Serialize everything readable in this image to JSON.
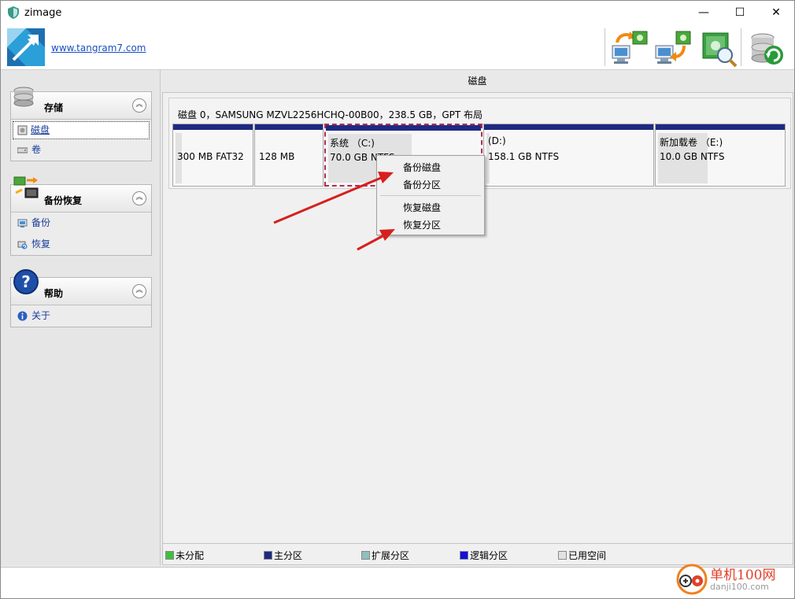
{
  "window": {
    "title": "zimage",
    "controls": [
      "—",
      "☐",
      "✕"
    ]
  },
  "header": {
    "site_link": "www.tangram7.com",
    "tools": [
      "backup-disk-icon",
      "restore-disk-icon",
      "browse-image-icon",
      "refresh-disk-icon"
    ]
  },
  "sidebar": {
    "panels": [
      {
        "title": "存储",
        "icon": "storage-icon",
        "items": [
          {
            "label": "磁盘",
            "icon": "disk-icon",
            "selected": true
          },
          {
            "label": "卷",
            "icon": "volume-icon",
            "selected": false
          }
        ]
      },
      {
        "title": "备份恢复",
        "icon": "backup-restore-icon",
        "items": [
          {
            "label": "备份",
            "icon": "backup-icon"
          },
          {
            "label": "恢复",
            "icon": "restore-icon"
          }
        ]
      },
      {
        "title": "帮助",
        "icon": "help-icon",
        "items": [
          {
            "label": "关于",
            "icon": "info-icon"
          }
        ]
      }
    ]
  },
  "main": {
    "title": "磁盘",
    "disk_label": "磁盘 0，SAMSUNG MZVL2256HCHQ-00B00，238.5 GB，GPT 布局",
    "partitions": [
      {
        "line1": "",
        "line2": "300 MB FAT32",
        "used_fraction": 0.08
      },
      {
        "line1": "",
        "line2": "128 MB",
        "used_fraction": 0.0
      },
      {
        "line1": "系统 （C:)",
        "line2": "70.0 GB NTFS",
        "used_fraction": 0.55
      },
      {
        "line1": "(D:)",
        "line2": "158.1 GB NTFS",
        "used_fraction": 0.02
      },
      {
        "line1": "新加载卷 （E:)",
        "line2": "10.0 GB NTFS",
        "used_fraction": 0.4
      }
    ]
  },
  "context_menu": {
    "items": [
      "备份磁盘",
      "备份分区",
      "恢复磁盘",
      "恢复分区"
    ]
  },
  "legend": [
    {
      "label": "未分配",
      "color": "#3fbf3f"
    },
    {
      "label": "主分区",
      "color": "#1e2a82"
    },
    {
      "label": "扩展分区",
      "color": "#8fbfbf"
    },
    {
      "label": "逻辑分区",
      "color": "#1010e0"
    },
    {
      "label": "已用空间",
      "color": "#e2e2e2"
    }
  ],
  "watermark": {
    "line1": "单机100网",
    "line2": "danji100.com"
  },
  "colors": {
    "accent_arrow": "#d81e1e",
    "partition_bar": "#1e2a82",
    "link": "#1a4fbf"
  }
}
